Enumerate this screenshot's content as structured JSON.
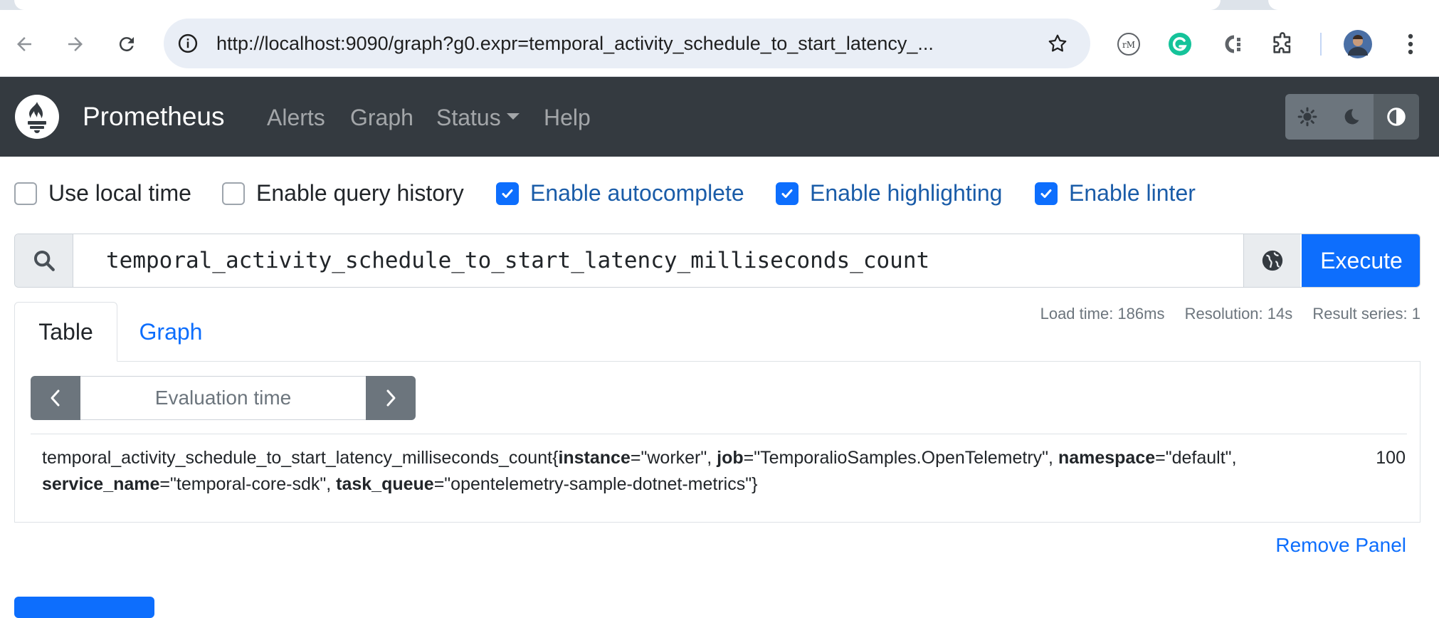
{
  "browser": {
    "url": "http://localhost:9090/graph?g0.expr=temporal_activity_schedule_to_start_latency_...",
    "icons": [
      "back-icon",
      "forward-icon",
      "reload-icon",
      "info-icon",
      "star-icon",
      "readermode-extension-icon",
      "grammarly-extension-icon",
      "extension-c-icon",
      "puzzle-extensions-icon",
      "profile-avatar",
      "kebab-menu-icon"
    ]
  },
  "nav": {
    "brand": "Prometheus",
    "links": [
      "Alerts",
      "Graph",
      "Status",
      "Help"
    ],
    "theme_icons": [
      "sun-icon",
      "moon-icon",
      "contrast-icon"
    ]
  },
  "options": [
    {
      "label": "Use local time",
      "checked": false
    },
    {
      "label": "Enable query history",
      "checked": false
    },
    {
      "label": "Enable autocomplete",
      "checked": true
    },
    {
      "label": "Enable highlighting",
      "checked": true
    },
    {
      "label": "Enable linter",
      "checked": true
    }
  ],
  "query": {
    "expr": "temporal_activity_schedule_to_start_latency_milliseconds_count",
    "execute_label": "Execute"
  },
  "panel": {
    "tabs": [
      "Table",
      "Graph"
    ],
    "active_tab": "Table",
    "stats": {
      "load_time": "Load time: 186ms",
      "resolution": "Resolution: 14s",
      "result_series": "Result series: 1"
    },
    "evaluation_placeholder": "Evaluation time",
    "result": {
      "metric": "temporal_activity_schedule_to_start_latency_milliseconds_count",
      "labels": [
        {
          "key": "instance",
          "value": "\"worker\""
        },
        {
          "key": "job",
          "value": "\"TemporalioSamples.OpenTelemetry\""
        },
        {
          "key": "namespace",
          "value": "\"default\""
        },
        {
          "key": "service_name",
          "value": "\"temporal-core-sdk\""
        },
        {
          "key": "task_queue",
          "value": "\"opentelemetry-sample-dotnet-metrics\""
        }
      ],
      "value": "100"
    },
    "remove_label": "Remove Panel"
  },
  "colors": {
    "navbar": "#343a40",
    "primary": "#0d6efd",
    "checked_label": "#1a5ca8"
  }
}
